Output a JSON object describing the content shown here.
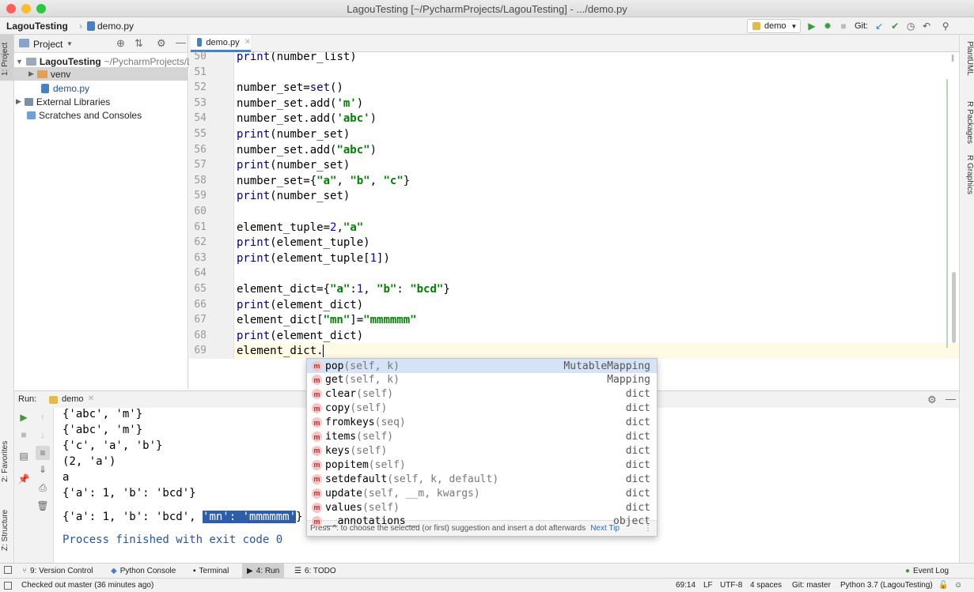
{
  "window": {
    "title": "LagouTesting [~/PycharmProjects/LagouTesting] - .../demo.py"
  },
  "navbar": {
    "project": "LagouTesting",
    "file": "demo.py",
    "run_config": "demo",
    "git_label": "Git:"
  },
  "left_stripe": {
    "project_tab": "1: Project",
    "favorites_tab": "2: Favorites",
    "structure_tab": "Z: Structure"
  },
  "right_stripe": {
    "plantuml": "PlantUML",
    "r_packages": "R Packages",
    "r_graphics": "R Graphics"
  },
  "project_panel": {
    "title": "Project",
    "tree": [
      {
        "label": "LagouTesting",
        "suffix": "~/PycharmProjects/L"
      },
      {
        "label": "venv"
      },
      {
        "label": "demo.py"
      },
      {
        "label": "External Libraries"
      },
      {
        "label": "Scratches and Consoles"
      }
    ]
  },
  "editor": {
    "tab_label": "demo.py",
    "line_numbers": [
      "50",
      "51",
      "52",
      "53",
      "54",
      "55",
      "56",
      "57",
      "58",
      "59",
      "60",
      "61",
      "62",
      "63",
      "64",
      "65",
      "66",
      "67",
      "68",
      "69"
    ],
    "lines": [
      [
        {
          "t": "print",
          "c": "kw"
        },
        {
          "t": "(number_list)",
          "c": ""
        }
      ],
      [],
      [
        {
          "t": "number_set=",
          "c": ""
        },
        {
          "t": "set",
          "c": "kw"
        },
        {
          "t": "()",
          "c": ""
        }
      ],
      [
        {
          "t": "number_set.add(",
          "c": ""
        },
        {
          "t": "'m'",
          "c": "str"
        },
        {
          "t": ")",
          "c": ""
        }
      ],
      [
        {
          "t": "number_set.add(",
          "c": ""
        },
        {
          "t": "'abc'",
          "c": "str"
        },
        {
          "t": ")",
          "c": ""
        }
      ],
      [
        {
          "t": "print",
          "c": "kw"
        },
        {
          "t": "(number_set)",
          "c": ""
        }
      ],
      [
        {
          "t": "number_set.add(",
          "c": ""
        },
        {
          "t": "\"abc\"",
          "c": "str"
        },
        {
          "t": ")",
          "c": ""
        }
      ],
      [
        {
          "t": "print",
          "c": "kw"
        },
        {
          "t": "(number_set)",
          "c": ""
        }
      ],
      [
        {
          "t": "number_set={",
          "c": ""
        },
        {
          "t": "\"a\"",
          "c": "str"
        },
        {
          "t": ", ",
          "c": ""
        },
        {
          "t": "\"b\"",
          "c": "str"
        },
        {
          "t": ", ",
          "c": ""
        },
        {
          "t": "\"c\"",
          "c": "str"
        },
        {
          "t": "}",
          "c": ""
        }
      ],
      [
        {
          "t": "print",
          "c": "kw"
        },
        {
          "t": "(number_set)",
          "c": ""
        }
      ],
      [],
      [
        {
          "t": "element_tuple=",
          "c": ""
        },
        {
          "t": "2",
          "c": "num"
        },
        {
          "t": ",",
          "c": ""
        },
        {
          "t": "\"a\"",
          "c": "str"
        }
      ],
      [
        {
          "t": "print",
          "c": "kw"
        },
        {
          "t": "(element_tuple)",
          "c": ""
        }
      ],
      [
        {
          "t": "print",
          "c": "kw"
        },
        {
          "t": "(element_tuple[",
          "c": ""
        },
        {
          "t": "1",
          "c": "num"
        },
        {
          "t": "])",
          "c": ""
        }
      ],
      [],
      [
        {
          "t": "element_dict={",
          "c": ""
        },
        {
          "t": "\"a\"",
          "c": "str"
        },
        {
          "t": ":",
          "c": ""
        },
        {
          "t": "1",
          "c": "num"
        },
        {
          "t": ", ",
          "c": ""
        },
        {
          "t": "\"b\"",
          "c": "str"
        },
        {
          "t": ": ",
          "c": ""
        },
        {
          "t": "\"bcd\"",
          "c": "str"
        },
        {
          "t": "}",
          "c": ""
        }
      ],
      [
        {
          "t": "print",
          "c": "kw"
        },
        {
          "t": "(element_dict)",
          "c": ""
        }
      ],
      [
        {
          "t": "element_dict[",
          "c": ""
        },
        {
          "t": "\"mn\"",
          "c": "str"
        },
        {
          "t": "]=",
          "c": ""
        },
        {
          "t": "\"mmmmmm\"",
          "c": "str"
        }
      ],
      [
        {
          "t": "print",
          "c": "kw"
        },
        {
          "t": "(element_dict)",
          "c": ""
        }
      ],
      [
        {
          "t": "element_dict.",
          "c": ""
        }
      ]
    ]
  },
  "completion": {
    "items": [
      {
        "name": "pop",
        "sig": "(self, k)",
        "type": "MutableMapping"
      },
      {
        "name": "get",
        "sig": "(self, k)",
        "type": "Mapping"
      },
      {
        "name": "clear",
        "sig": "(self)",
        "type": "dict"
      },
      {
        "name": "copy",
        "sig": "(self)",
        "type": "dict"
      },
      {
        "name": "fromkeys",
        "sig": "(seq)",
        "type": "dict"
      },
      {
        "name": "items",
        "sig": "(self)",
        "type": "dict"
      },
      {
        "name": "keys",
        "sig": "(self)",
        "type": "dict"
      },
      {
        "name": "popitem",
        "sig": "(self)",
        "type": "dict"
      },
      {
        "name": "setdefault",
        "sig": "(self, k, default)",
        "type": "dict"
      },
      {
        "name": "update",
        "sig": "(self, __m, kwargs)",
        "type": "dict"
      },
      {
        "name": "values",
        "sig": "(self)",
        "type": "dict"
      },
      {
        "name": "__annotations__",
        "sig": "",
        "type": "object"
      }
    ],
    "footer": "Press ^. to choose the selected (or first) suggestion and insert a dot afterwards",
    "next_tip": "Next Tip"
  },
  "run_panel": {
    "label": "Run:",
    "tab": "demo",
    "output": [
      "{'abc', 'm'}",
      "{'abc', 'm'}",
      "{'c', 'a', 'b'}",
      "(2, 'a')",
      "a",
      "{'a': 1, 'b': 'bcd'}"
    ],
    "last_prefix": "{'a': 1, 'b': 'bcd', ",
    "last_highlight": "'mn': 'mmmmmm'",
    "last_suffix": "}",
    "finished": "Process finished with exit code 0"
  },
  "bottom_tools": [
    {
      "label": "9: Version Control"
    },
    {
      "label": "Python Console"
    },
    {
      "label": "Terminal"
    },
    {
      "label": "4: Run"
    },
    {
      "label": "6: TODO"
    }
  ],
  "event_log": "Event Log",
  "status": {
    "message": "Checked out master (36 minutes ago)",
    "position": "69:14",
    "line_sep": "LF",
    "encoding": "UTF-8",
    "indent": "4 spaces",
    "git": "Git: master",
    "interpreter": "Python 3.7 (LagouTesting)"
  },
  "colors": {
    "accent": "#4083c9",
    "keyword": "#000080",
    "string": "#008000",
    "number": "#0000ff",
    "selection": "#2e5ea8"
  }
}
